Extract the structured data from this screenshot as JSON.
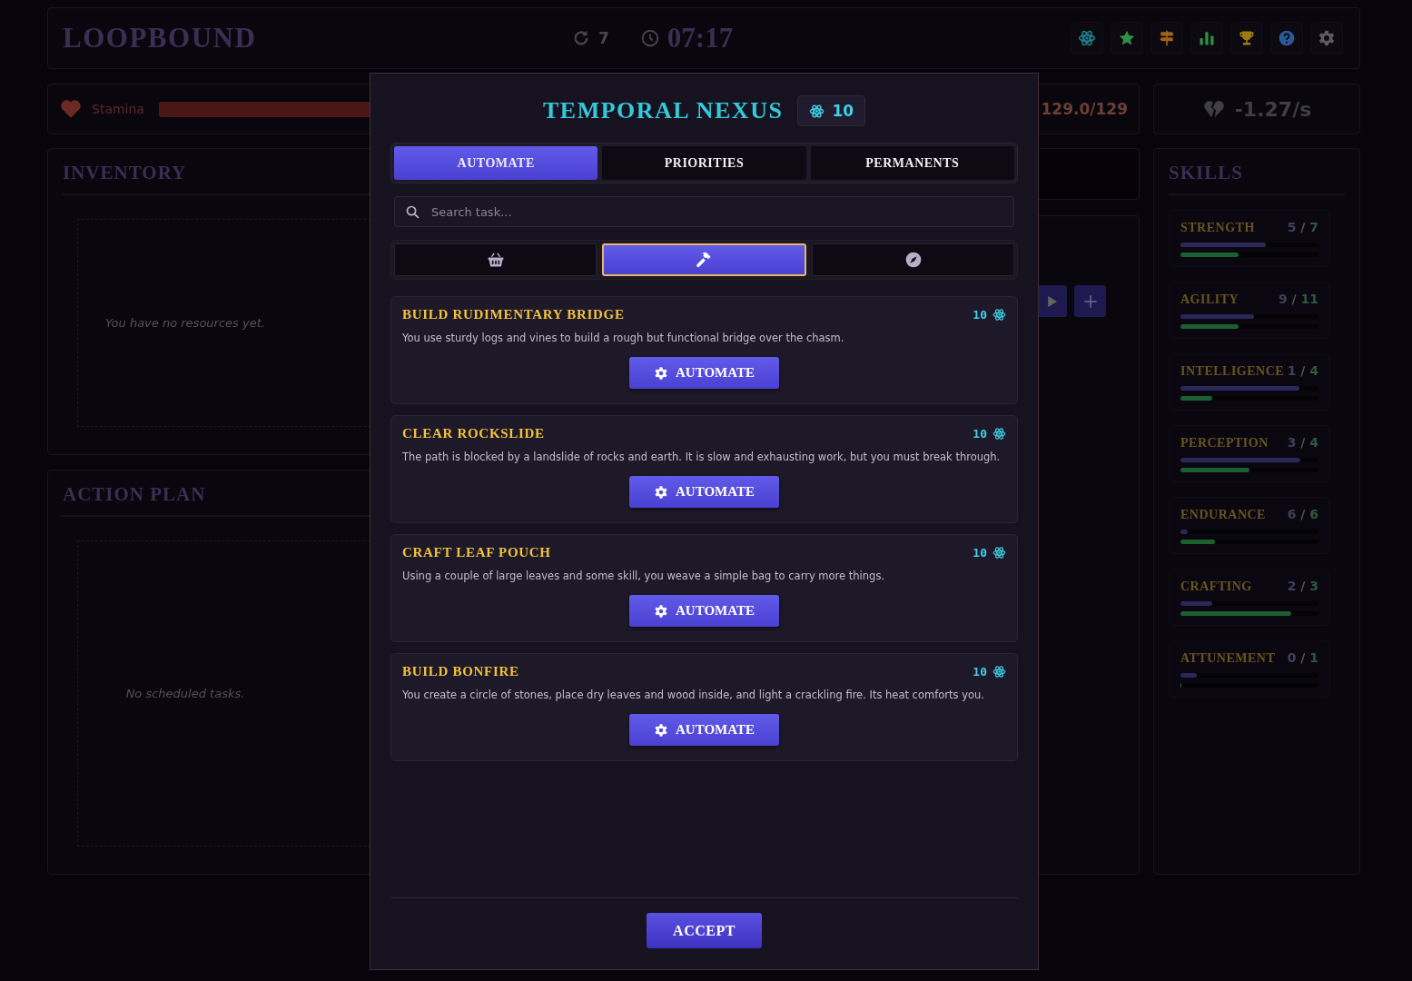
{
  "header": {
    "title": "LOOPBOUND",
    "loops": "7",
    "time": "07:17",
    "toolbar": [
      {
        "kind": "atom"
      },
      {
        "kind": "star"
      },
      {
        "kind": "signpost"
      },
      {
        "kind": "chart"
      },
      {
        "kind": "trophy"
      },
      {
        "kind": "help"
      },
      {
        "kind": "settings"
      }
    ]
  },
  "stamina": {
    "label": "Stamina",
    "level": 1,
    "reading": "129.0/129"
  },
  "drain": {
    "reading": "-1.27/s"
  },
  "inventory": {
    "title": "INVENTORY",
    "empty_text": "You have no resources yet."
  },
  "action_plan": {
    "title": "ACTION PLAN",
    "empty_text": "No scheduled tasks."
  },
  "queue_controls": [
    {
      "kind": "play"
    },
    {
      "kind": "plus"
    }
  ],
  "skills": {
    "title": "SKILLS",
    "separator": "/",
    "items": [
      {
        "name": "STRENGTH",
        "current": "5",
        "max": "7",
        "progress": {
          "level": 0.62
        },
        "mastery": {
          "level": 0.42
        }
      },
      {
        "name": "AGILITY",
        "current": "9",
        "max": "11",
        "progress": {
          "level": 0.53
        },
        "mastery": {
          "level": 0.42
        }
      },
      {
        "name": "INTELLIGENCE",
        "current": "1",
        "max": "4",
        "progress": {
          "level": 0.86
        },
        "mastery": {
          "level": 0.23
        }
      },
      {
        "name": "PERCEPTION",
        "current": "3",
        "max": "4",
        "progress": {
          "level": 0.87
        },
        "mastery": {
          "level": 0.5
        }
      },
      {
        "name": "ENDURANCE",
        "current": "6",
        "max": "6",
        "progress": {
          "level": 0.05
        },
        "mastery": {
          "level": 0.25
        }
      },
      {
        "name": "CRAFTING",
        "current": "2",
        "max": "3",
        "progress": {
          "level": 0.23
        },
        "mastery": {
          "level": 0.8
        }
      },
      {
        "name": "ATTUNEMENT",
        "current": "0",
        "max": "1",
        "progress": {
          "level": 0.12
        },
        "mastery": {
          "level": 0
        }
      }
    ]
  },
  "modal": {
    "title": "TEMPORAL NEXUS",
    "points": "10",
    "tabs": [
      {
        "label": "AUTOMATE",
        "selected": true
      },
      {
        "label": "PRIORITIES",
        "selected": false
      },
      {
        "label": "PERMANENTS",
        "selected": false
      }
    ],
    "search": {
      "placeholder": "Search task..."
    },
    "categories": [
      {
        "kind": "basket",
        "selected": false
      },
      {
        "kind": "hammer",
        "selected": true
      },
      {
        "kind": "compass",
        "selected": false
      }
    ],
    "tasks": [
      {
        "title": "BUILD RUDIMENTARY BRIDGE",
        "cost": "10",
        "description": "You use sturdy logs and vines to build a rough but functional bridge over the chasm.",
        "button": "AUTOMATE"
      },
      {
        "title": "CLEAR ROCKSLIDE",
        "cost": "10",
        "description": "The path is blocked by a landslide of rocks and earth. It is slow and exhausting work, but you must break through.",
        "button": "AUTOMATE"
      },
      {
        "title": "CRAFT LEAF POUCH",
        "cost": "10",
        "description": "Using a couple of large leaves and some skill, you weave a simple bag to carry more things.",
        "button": "AUTOMATE"
      },
      {
        "title": "BUILD BONFIRE",
        "cost": "10",
        "description": "You create a circle of stones, place dry leaves and wood inside, and light a crackling fire. Its heat comforts you.",
        "button": "AUTOMATE"
      }
    ],
    "accept": "ACCEPT"
  }
}
